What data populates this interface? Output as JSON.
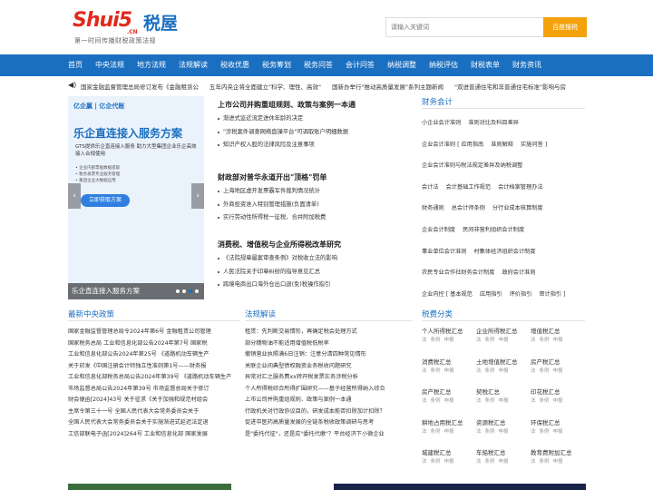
{
  "logo": {
    "main": "Shui5",
    "house": "税屋",
    "cn": ".CN",
    "sub": "第一时间传播财税政策法规"
  },
  "search": {
    "placeholder": "请输入关键词",
    "button": "百度搜税"
  },
  "nav": [
    "首页",
    "中央法规",
    "地方法规",
    "法规解读",
    "税收优惠",
    "税务筹划",
    "税务问答",
    "会计问答",
    "纳税调整",
    "纳税评估",
    "财税表单",
    "财务资讯"
  ],
  "ticker": [
    "国家金融监督管理总局修订发布《金融租赁公",
    "五年内央企将全面建立\"科学、理性、高效\"",
    "国新办举行\"推动高质量发展\"系列主题新闻",
    "\"双进普通住宅和非普通住宅标准\"影响与房"
  ],
  "banner": {
    "head": "亿企赢 | 亿企代账",
    "title": "乐企直连接入服务方案",
    "desc": "GTS提供乐企直连接入服务 助力大型集团企业乐企高效接入合规使用",
    "points": [
      "• 企业内部票据数据提取",
      "• 税务发票专业服务管理",
      "• 集团企业大数据应用"
    ],
    "btn": "立即获取方案",
    "caption": "乐企直连接入服务方案"
  },
  "mid": [
    {
      "title": "上市公司并购重组规则、政策与案例一本通",
      "items": [
        "渐进式监近流定进休年龄的决定",
        "\"涉税案件调查网络盘操平台\"可调取账户明细数据",
        "知识产权入股的法律风险及注意事项"
      ]
    },
    {
      "title": "财政部对普华永道开出\"顶格\"罚单",
      "items": [
        "上海地区虚开发票霸军件裁判情况统计",
        "外商投资准入特别管理措施(负面清单)",
        "实行劳动性所得税一征税、合并附加税费"
      ]
    },
    {
      "title": "消费税、增值税与企业所得税改革研究",
      "items": [
        "《法院规章最案审查条例》对税收立法的影响",
        "人民法院关于印章纠纷的指导意见汇总",
        "跨境电商出口海外仓出口退(免)税操作指引"
      ]
    }
  ],
  "right": {
    "title": "财务会计",
    "rows": [
      [
        "小企业会计准则",
        "准则对比及科目差异"
      ],
      [
        "企业会计准则 [ 应用指南",
        "准则解释",
        "实施问答 ]"
      ],
      [
        "企业会计准则与税法规定差异及纳税调整"
      ],
      [
        "会计法",
        "会计基础工作规范",
        "会计档案管理办法"
      ],
      [
        "财务通则",
        "总会计师条例",
        "分行业成本核算制度"
      ],
      [
        "企业会计制度",
        "民间非营利组织会计制度"
      ],
      [
        "事业单位会计准则",
        "村集体经济组织会计制度"
      ],
      [
        "农民专业合作社财务会计制度",
        "政府会计准则"
      ],
      [
        "企业内控 [ 基本规范",
        "应用指引",
        "评价指引",
        "审计指引 ]"
      ]
    ]
  },
  "col1": {
    "title": "最新中央政策",
    "items": [
      "国家金融监督管理总局令2024年第6号 金融租赁公司管理",
      "国家税务总局 工业和信息化部公告2024年第7号 国家税",
      "工业和信息化部公告2024年第25号 《道路机动车辆生产",
      "关于印发《中国注册会计师独立性准则第1号——财务报",
      "工业和信息化部税务总局公告2024年第39号 《道路机动车辆生产",
      "市场监督总局公告2024年第39号 市场监督总局关于修订",
      "财会便函[2024]43号 关于征求《关于加强和规范村组会",
      "主席令第三十一号 全国人民代表大会常务委员会关于",
      "全国人民代表大会常务委员会关于实施渐进式延迟法定退",
      "工信部联电子函[2024]264号 工业和信息化部 国家发展"
    ]
  },
  "col2": {
    "title": "法规解读",
    "items": [
      "租赁：先判断交易情形，再确定税会处理方式",
      "部分穗物油不能适用增值税低税率",
      "撤销营业执照满6日注销：注意分清四种常见情形",
      "关联企业间典型债权融资业务税收问题研究",
      "异常对汇之服务费xx转开税发票实务涉税分析",
      "个人所得税综合所得扩围研究——基于经营所得纳入综合",
      "上市公司并购重组规则、政策与案例一本通",
      "行政机关对行政协议目的，研发成本能否扣除加计扣除？",
      "促进中医药高质量发展的全链条税收政策调研与思考",
      "是\"委托代征\"，还是应\"委托代缴\"？平台经济下小微企业"
    ]
  },
  "col3": {
    "title": "税费分类",
    "taxes": [
      "个人所得税汇总",
      "企业所得税汇总",
      "增值税汇总",
      "消费税汇总",
      "土地增值税汇总",
      "房产税汇总",
      "房产税汇总",
      "契税汇总",
      "印花税汇总",
      "耕地占用税汇总",
      "资源税汇总",
      "环保税汇总",
      "城建税汇总",
      "车船税汇总",
      "教育费附加汇总"
    ],
    "subs": [
      "法",
      "条例",
      "申报"
    ]
  }
}
